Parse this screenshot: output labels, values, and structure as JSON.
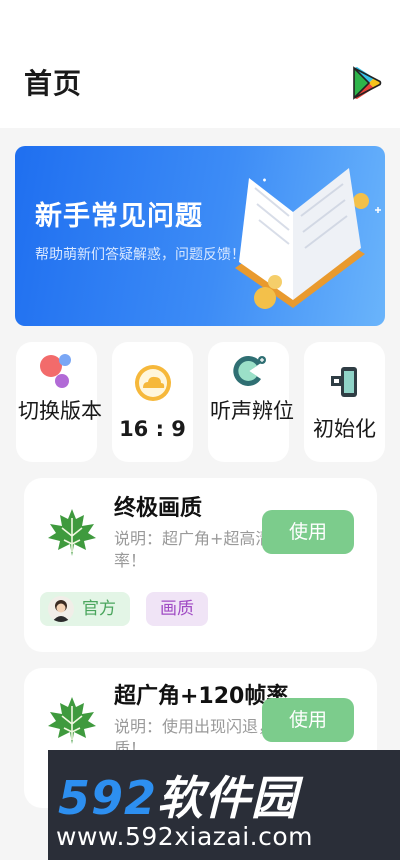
{
  "header": {
    "title": "首页",
    "store_icon": "google-play-icon"
  },
  "banner": {
    "title": "新手常见问题",
    "subtitle": "帮助萌新们答疑解惑，问题反馈！",
    "icon": "open-book-icon"
  },
  "quick_actions": [
    {
      "label": "切换版本",
      "icon": "balloons-icon"
    },
    {
      "label": "16 : 9",
      "icon": "cloud-icon"
    },
    {
      "label": "听声辨位",
      "icon": "pacman-sound-icon"
    },
    {
      "label": "初始化",
      "icon": "reset-device-icon"
    }
  ],
  "cards": [
    {
      "title": "终极画质",
      "desc": "说明：超广角+超高清画质，帧率！",
      "button": "使用",
      "tags": [
        "官方",
        "画质"
      ],
      "icon": "maple-leaf-icon"
    },
    {
      "title": "超广角+120帧率",
      "desc": "说明：使用出现闪退，请初始化画质！",
      "button": "使用",
      "icon": "maple-leaf-icon"
    }
  ],
  "watermark": {
    "brand_num": "592",
    "brand_cn": "软件园",
    "url": "www.592xiazai.com"
  },
  "colors": {
    "primary_green": "#7ccc8c",
    "banner_blue": "#1f6ff0",
    "watermark_bg": "#2a2e38"
  }
}
